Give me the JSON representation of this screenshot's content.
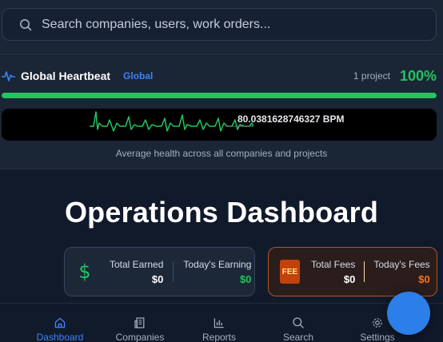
{
  "search": {
    "placeholder": "Search companies, users, work orders..."
  },
  "heartbeat": {
    "title": "Global Heartbeat",
    "scope": "Global",
    "projects": "1 project",
    "percent_text": "100%",
    "health_fraction": 1.0,
    "bpm": "80.0381628746327 BPM",
    "caption": "Average health across all companies and projects"
  },
  "page_title": "Operations Dashboard",
  "earnings_card": {
    "total_label": "Total Earned",
    "total_value": "$0",
    "today_label": "Today's Earning",
    "today_value": "$0"
  },
  "fees_card": {
    "icon_text": "FEE",
    "total_label": "Total Fees",
    "total_value": "$0",
    "today_label": "Today's Fees",
    "today_value": "$0"
  },
  "nav": [
    {
      "label": "Dashboard",
      "icon": "home-icon",
      "active": true
    },
    {
      "label": "Companies",
      "icon": "building-icon",
      "active": false
    },
    {
      "label": "Reports",
      "icon": "bar-chart-icon",
      "active": false
    },
    {
      "label": "Search",
      "icon": "search-icon",
      "active": false
    },
    {
      "label": "Settings",
      "icon": "gear-icon",
      "active": false
    }
  ],
  "colors": {
    "accent": "#3b82f6",
    "success": "#22c55e",
    "fee": "#f97316"
  }
}
